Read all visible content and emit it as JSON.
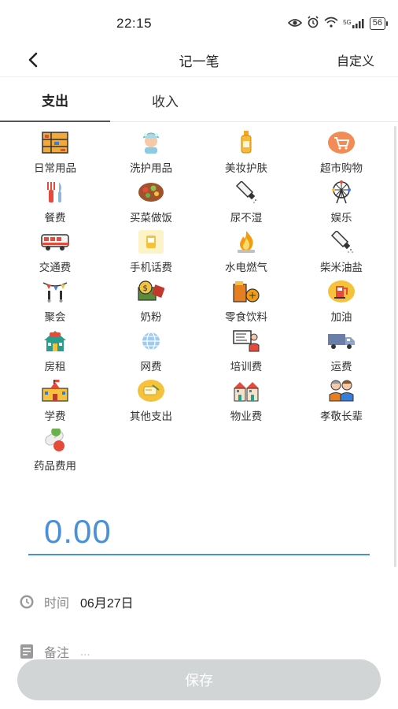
{
  "status_bar": {
    "time": "22:15",
    "network": "5G",
    "battery": "56"
  },
  "nav": {
    "title": "记一笔",
    "custom_label": "自定义"
  },
  "tabs": [
    {
      "label": "支出",
      "active": true
    },
    {
      "label": "收入",
      "active": false
    }
  ],
  "categories": [
    {
      "label": "日常用品",
      "icon": "shelf-icon"
    },
    {
      "label": "洗护用品",
      "icon": "shower-icon"
    },
    {
      "label": "美妆护肤",
      "icon": "lotion-bottle-icon"
    },
    {
      "label": "超市购物",
      "icon": "shopping-cart-icon"
    },
    {
      "label": "餐费",
      "icon": "fork-knife-icon"
    },
    {
      "label": "买菜做饭",
      "icon": "food-bowl-icon"
    },
    {
      "label": "尿不湿",
      "icon": "tube-icon"
    },
    {
      "label": "娱乐",
      "icon": "ferris-wheel-icon"
    },
    {
      "label": "交通费",
      "icon": "bus-icon"
    },
    {
      "label": "手机话费",
      "icon": "phone-icon"
    },
    {
      "label": "水电燃气",
      "icon": "flame-icon"
    },
    {
      "label": "柴米油盐",
      "icon": "salt-icon"
    },
    {
      "label": "聚会",
      "icon": "party-icon"
    },
    {
      "label": "奶粉",
      "icon": "money-icon"
    },
    {
      "label": "零食饮料",
      "icon": "drink-icon"
    },
    {
      "label": "加油",
      "icon": "fuel-pump-icon"
    },
    {
      "label": "房租",
      "icon": "house-icon"
    },
    {
      "label": "网费",
      "icon": "globe-icon"
    },
    {
      "label": "培训费",
      "icon": "teacher-icon"
    },
    {
      "label": "运费",
      "icon": "truck-icon"
    },
    {
      "label": "学费",
      "icon": "school-icon"
    },
    {
      "label": "其他支出",
      "icon": "card-icon"
    },
    {
      "label": "物业费",
      "icon": "buildings-icon"
    },
    {
      "label": "孝敬长辈",
      "icon": "elders-icon"
    },
    {
      "label": "药品费用",
      "icon": "pills-icon"
    }
  ],
  "amount": "0.00",
  "time_row": {
    "label": "时间",
    "value": "06月27日"
  },
  "note_row": {
    "label": "备注",
    "placeholder": "..."
  },
  "save_label": "保存",
  "colors": {
    "accent": "#4a90d9",
    "save_button": "#d2d5d6",
    "text": "#222222",
    "muted": "#888888"
  }
}
